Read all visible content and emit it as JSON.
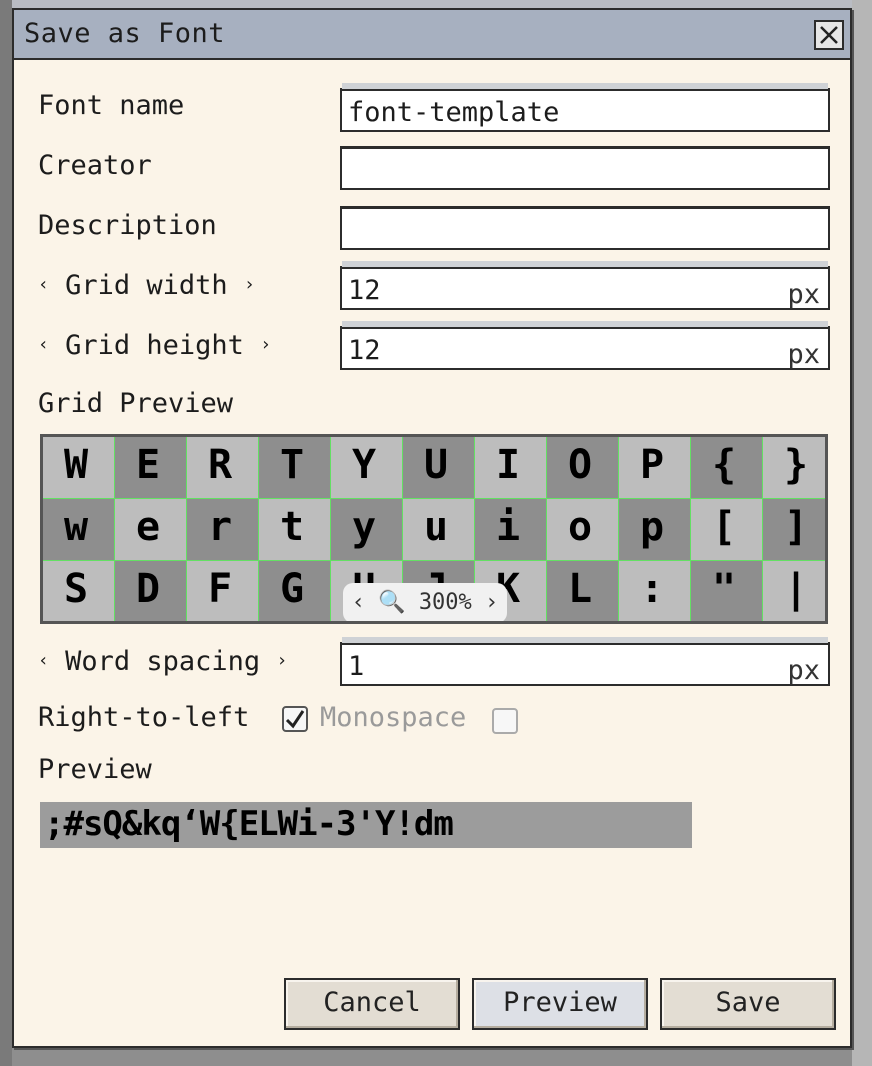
{
  "dialog": {
    "title": "Save as Font",
    "close_icon": "close-icon"
  },
  "fields": {
    "font_name": {
      "label": "Font name",
      "value": "font-template"
    },
    "creator": {
      "label": "Creator",
      "value": ""
    },
    "description": {
      "label": "Description",
      "value": ""
    },
    "grid_width": {
      "label": "Grid width",
      "value": "12",
      "unit": "px"
    },
    "grid_height": {
      "label": "Grid height",
      "value": "12",
      "unit": "px"
    },
    "word_spacing": {
      "label": "Word spacing",
      "value": "1",
      "unit": "px"
    }
  },
  "arrows": {
    "left": "‹",
    "right": "›"
  },
  "grid_preview": {
    "label": "Grid Preview",
    "zoom": "‹ 🔍 300% ›",
    "rows": [
      [
        "W",
        "E",
        "R",
        "T",
        "Y",
        "U",
        "I",
        "O",
        "P",
        "{",
        "}"
      ],
      [
        "w",
        "e",
        "r",
        "t",
        "y",
        "u",
        "i",
        "o",
        "p",
        "[",
        "]"
      ],
      [
        "S",
        "D",
        "F",
        "G",
        "H",
        "J",
        "K",
        "L",
        ":",
        "\"",
        "|"
      ]
    ]
  },
  "options": {
    "right_to_left": {
      "label": "Right-to-left",
      "checked": true
    },
    "monospace": {
      "label": "Monospace",
      "checked": false,
      "disabled": true
    }
  },
  "preview": {
    "label": "Preview",
    "text": ";#sQ&kq‘W{ELWi-3'Y!dm"
  },
  "buttons": {
    "cancel": "Cancel",
    "preview": "Preview",
    "save": "Save"
  },
  "colors": {
    "titlebar": "#a7b0c0",
    "dialog_bg": "#fbf4e8",
    "grid_line": "#63e063"
  }
}
